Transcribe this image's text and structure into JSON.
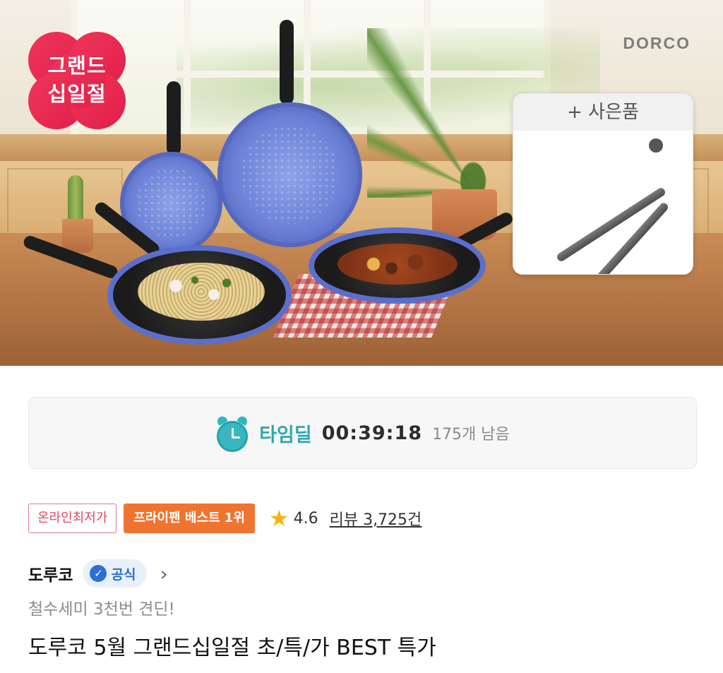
{
  "hero": {
    "badge_line1": "그랜드",
    "badge_line2": "십일절",
    "brand_logo": "DORCO",
    "gift_label": "+ 사은품"
  },
  "timedeal": {
    "label": "타임딜",
    "timer": "00:39:18",
    "remaining": "175개 남음",
    "icon": "alarm-clock-icon",
    "accent_color": "#2ea7ae"
  },
  "tags": {
    "lowest_price": "온라인최저가",
    "best_rank": "프라이팬 베스트 1위"
  },
  "rating": {
    "score": "4.6",
    "review_label": "리뷰 3,725건",
    "star_color": "#f4b216"
  },
  "seller": {
    "name": "도루코",
    "official_label": "공식"
  },
  "product": {
    "subtitle": "철수세미 3천번 견딘!",
    "title": "도루코 5월 그랜드십일절 초/특/가 BEST 특가"
  }
}
